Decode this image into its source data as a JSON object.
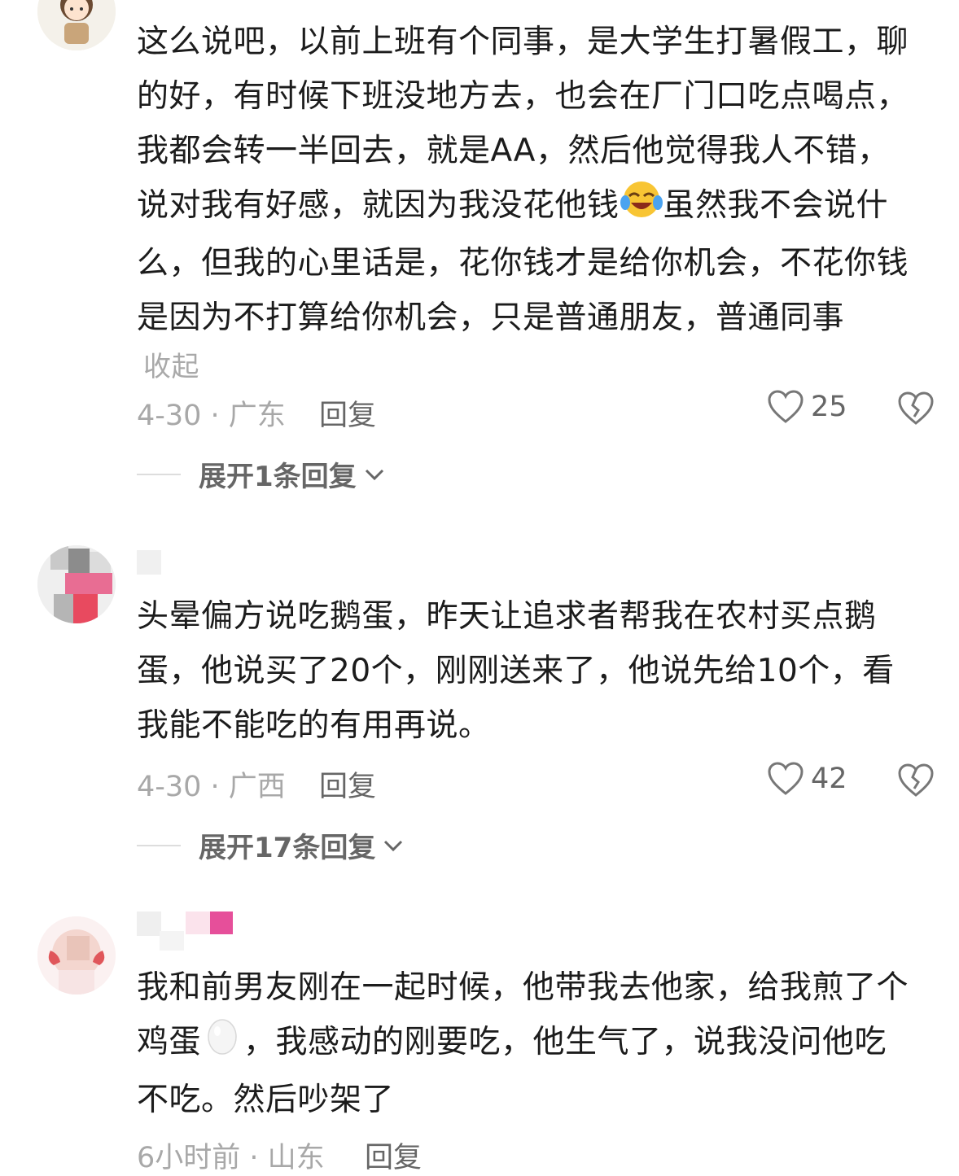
{
  "comments": [
    {
      "lines": [
        "这么说吧，以前上班有个同事，是大学生打暑假工，聊",
        "的好，有时候下班没地方去，也会在厂门口吃点喝点，",
        "我都会转一半回去，就是AA，然后他觉得我人不错，"
      ],
      "line4_before": "说对我有好感，就因为我没花他钱",
      "line4_emoji": "laughing-crying-emoji",
      "line4_after": "虽然我不会说什",
      "lines_end": [
        "么，但我的心里话是，花你钱才是给你机会，不花你钱",
        "是因为不打算给你机会，只是普通朋友，普通同事"
      ],
      "collapse_label": "收起",
      "time_location": "4-30 · 广东",
      "reply_label": "回复",
      "likes": "25",
      "expand_label": "展开1条回复"
    },
    {
      "lines": [
        "头晕偏方说吃鹅蛋，昨天让追求者帮我在农村买点鹅",
        "蛋，他说买了20个，刚刚送来了，他说先给10个，看",
        "我能不能吃的有用再说。"
      ],
      "time_location": "4-30 · 广西",
      "reply_label": "回复",
      "likes": "42",
      "expand_label": "展开17条回复"
    },
    {
      "line1": "我和前男友刚在一起时候，他带我去他家，给我煎了个",
      "line2_before": "鸡蛋",
      "line2_emoji": "egg-emoji",
      "line2_after": "，我感动的刚要吃，他生气了，说我没问他吃",
      "line3": "不吃。然后吵架了",
      "time_location": "6小时前 · 山东",
      "reply_label": "回复"
    }
  ],
  "colors": {
    "text": "#1c1c1c",
    "meta": "#a8a8a8",
    "action": "#666666"
  }
}
